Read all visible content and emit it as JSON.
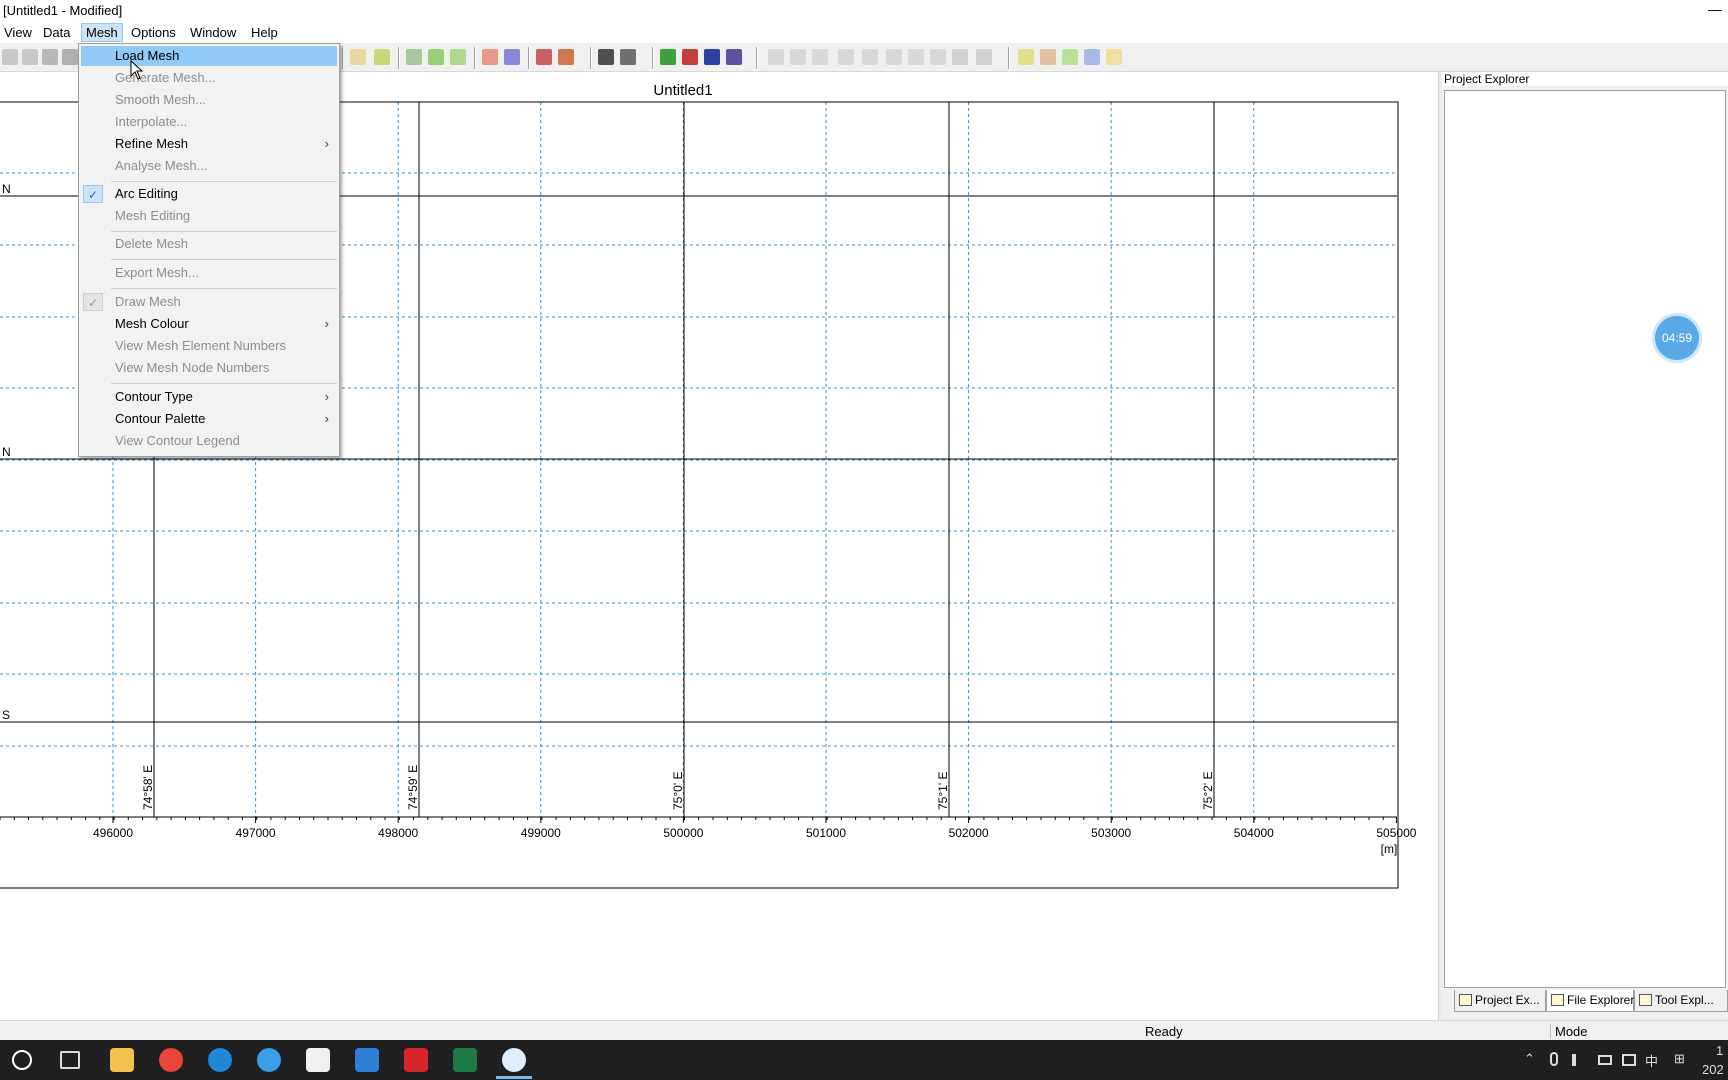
{
  "window": {
    "title": "[Untitled1 - Modified]",
    "minimize_glyph": "—"
  },
  "menubar": [
    "View",
    "Data",
    "Mesh",
    "Options",
    "Window",
    "Help"
  ],
  "chart": {
    "title": "Untitled1",
    "x_ticks": [
      "496000",
      "497000",
      "498000",
      "499000",
      "500000",
      "501000",
      "502000",
      "503000",
      "504000",
      "505000"
    ],
    "x_unit": "[m]",
    "lon_labels": [
      "74°58' E",
      "74°59' E",
      "75°0' E",
      "75°1' E",
      "75°2' E"
    ],
    "lat_labels": [
      "N",
      "N",
      "S"
    ]
  },
  "mesh_menu": {
    "items": [
      {
        "label": "Load Mesh",
        "enabled": true,
        "highlighted": true
      },
      {
        "label": "Generate Mesh...",
        "enabled": false
      },
      {
        "label": "Smooth Mesh...",
        "enabled": false
      },
      {
        "label": "Interpolate...",
        "enabled": false
      },
      {
        "label": "Refine Mesh",
        "enabled": true,
        "submenu": true
      },
      {
        "label": "Analyse Mesh...",
        "enabled": false
      },
      {
        "label": "Arc Editing",
        "enabled": true,
        "checked": true
      },
      {
        "label": "Mesh Editing",
        "enabled": false
      },
      {
        "label": "Delete Mesh",
        "enabled": false
      },
      {
        "label": "Export Mesh...",
        "enabled": false
      },
      {
        "label": "Draw Mesh",
        "enabled": false,
        "checked": true
      },
      {
        "label": "Mesh Colour",
        "enabled": true,
        "submenu": true
      },
      {
        "label": "View Mesh Element Numbers",
        "enabled": false
      },
      {
        "label": "View Mesh Node Numbers",
        "enabled": false
      },
      {
        "label": "Contour Type",
        "enabled": true,
        "submenu": true
      },
      {
        "label": "Contour Palette",
        "enabled": true,
        "submenu": true
      },
      {
        "label": "View Contour Legend",
        "enabled": false
      }
    ],
    "check_glyph": "✓",
    "submenu_glyph": "›"
  },
  "explorer": {
    "header": "Project Explorer",
    "tabs": [
      "Project Ex...",
      "File Explorer",
      "Tool Expl..."
    ]
  },
  "timer": "04:59",
  "status": {
    "ready": "Ready",
    "mode": "Mode"
  },
  "taskbar": {
    "tray_ime": "中",
    "tray_grid": "⊞",
    "clock_top": "1",
    "clock_bottom": "202"
  },
  "colors": {
    "menu_highlight": "#91c9f7",
    "grid_dashed": "#3a8fc8",
    "grid_solid": "#000000",
    "timer": "#5aa9e6"
  }
}
